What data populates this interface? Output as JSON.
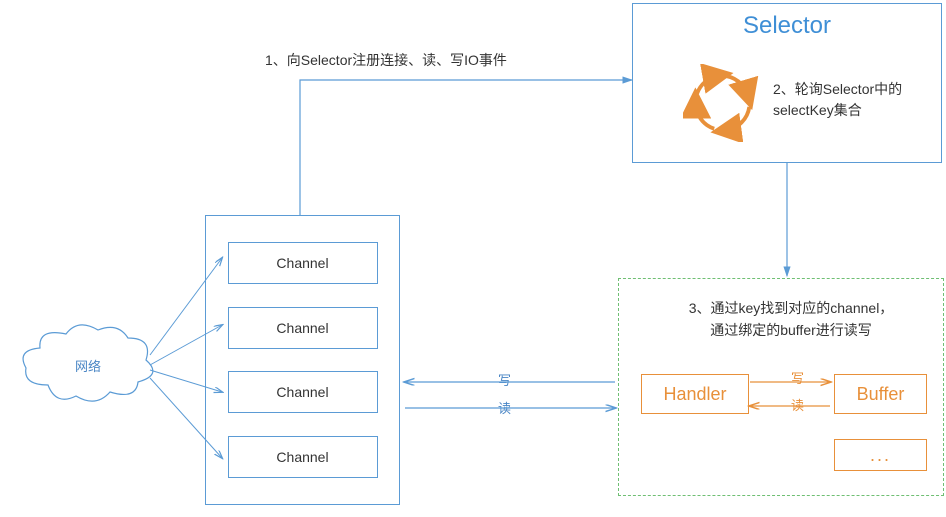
{
  "step1_label": "1、向Selector注册连接、读、写IO事件",
  "network_label": "网络",
  "channels": {
    "items": [
      "Channel",
      "Channel",
      "Channel",
      "Channel"
    ]
  },
  "selector": {
    "title": "Selector",
    "step2_line1": "2、轮询Selector中的",
    "step2_line2": "selectKey集合"
  },
  "rw": {
    "write": "写",
    "read": "读"
  },
  "result": {
    "step3_line1": "3、通过key找到对应的channel，",
    "step3_line2": "通过绑定的buffer进行读写",
    "handler": "Handler",
    "buffer": "Buffer",
    "more": "...",
    "write": "写",
    "read": "读"
  }
}
